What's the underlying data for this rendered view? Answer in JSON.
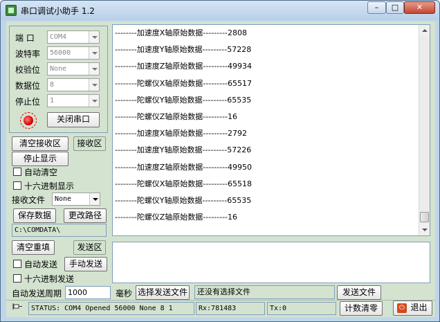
{
  "window": {
    "title": "串口调试小助手 1.2",
    "controls": {
      "minimize": "–",
      "maximize": "□",
      "close": "✕"
    }
  },
  "port_settings": {
    "port_label": "端  口",
    "port_value": "COM4",
    "baud_label": "波特率",
    "baud_value": "56000",
    "parity_label": "校验位",
    "parity_value": "None",
    "databits_label": "数据位",
    "databits_value": "8",
    "stopbits_label": "停止位",
    "stopbits_value": "1",
    "open_close_button": "关闭串口",
    "led_color": "#e00000"
  },
  "receive_controls": {
    "clear_button": "清空接收区",
    "recv_area_button": "接收区",
    "stop_display_button": "停止显示",
    "auto_clear_label": "自动清空",
    "hex_display_label": "十六进制显示",
    "recv_file_label": "接收文件",
    "recv_file_value": "None",
    "save_data_button": "保存数据",
    "change_path_button": "更改路径",
    "path_value": "C:\\COMDATA\\"
  },
  "receive_area": {
    "lines": [
      "--------加速度X轴原始数据---------2808",
      "--------加速度Y轴原始数据---------57228",
      "--------加速度Z轴原始数据---------49934",
      "--------陀螺仪X轴原始数据---------65517",
      "--------陀螺仪Y轴原始数据---------65535",
      "--------陀螺仪Z轴原始数据---------16",
      "--------加速度X轴原始数据---------2792",
      "--------加速度Y轴原始数据---------57226",
      "--------加速度Z轴原始数据---------49950",
      "--------陀螺仪X轴原始数据---------65518",
      "--------陀螺仪Y轴原始数据---------65535",
      "--------陀螺仪Z轴原始数据---------16"
    ]
  },
  "send_controls": {
    "clear_resend_button": "清空重填",
    "send_area_button": "发送区",
    "auto_send_label": "自动发送",
    "manual_send_button": "手动发送",
    "hex_send_label": "十六进制发送",
    "period_label": "自动发送周期",
    "period_value": "1000",
    "ms_label": "毫秒",
    "select_file_button": "选择发送文件",
    "file_status": "还没有选择文件",
    "send_file_button": "发送文件"
  },
  "status_bar": {
    "status_text": "STATUS: COM4 Opened 56000 None 8 1",
    "rx_text": "Rx:781483",
    "tx_text": "Tx:0",
    "reset_count_button": "计数清零",
    "exit_button": "退出"
  },
  "icons": {
    "app": "serial-port-icon",
    "pin": "pin-icon",
    "exit": "exit-icon"
  }
}
